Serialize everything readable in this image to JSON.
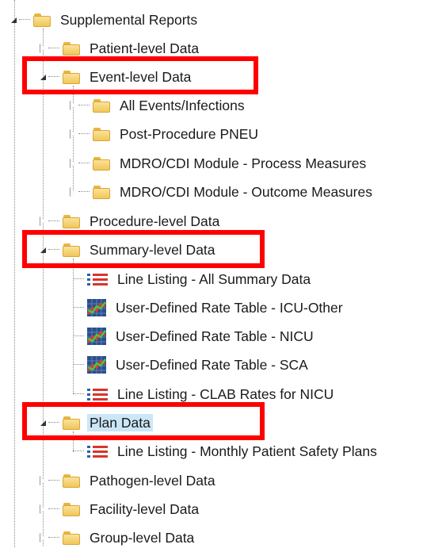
{
  "tree": {
    "root": {
      "label": "Supplemental Reports",
      "expanded": true
    },
    "items": [
      {
        "label": "Patient-level Data",
        "expanded": false
      },
      {
        "label": "Event-level Data",
        "expanded": true,
        "children": [
          {
            "label": "All Events/Infections",
            "type": "folder",
            "expanded": false
          },
          {
            "label": "Post-Procedure PNEU",
            "type": "folder",
            "expanded": false
          },
          {
            "label": "MDRO/CDI Module - Process Measures",
            "type": "folder",
            "expanded": false
          },
          {
            "label": "MDRO/CDI Module - Outcome Measures",
            "type": "folder",
            "expanded": false
          }
        ]
      },
      {
        "label": "Procedure-level Data",
        "expanded": false
      },
      {
        "label": "Summary-level Data",
        "expanded": true,
        "children": [
          {
            "label": "Line Listing - All Summary Data",
            "type": "line-listing"
          },
          {
            "label": "User-Defined Rate Table - ICU-Other",
            "type": "rate-table"
          },
          {
            "label": "User-Defined Rate Table - NICU",
            "type": "rate-table"
          },
          {
            "label": "User-Defined Rate Table - SCA",
            "type": "rate-table"
          },
          {
            "label": "Line Listing - CLAB Rates for NICU",
            "type": "line-listing"
          }
        ]
      },
      {
        "label": "Plan Data",
        "expanded": true,
        "selected": true,
        "children": [
          {
            "label": "Line Listing - Monthly Patient Safety Plans",
            "type": "line-listing"
          }
        ]
      },
      {
        "label": "Pathogen-level Data",
        "expanded": false
      },
      {
        "label": "Facility-level Data",
        "expanded": false
      },
      {
        "label": "Group-level Data",
        "expanded": false
      }
    ]
  },
  "highlight_color": "#ff0000",
  "selection_color": "#cbe6f7"
}
